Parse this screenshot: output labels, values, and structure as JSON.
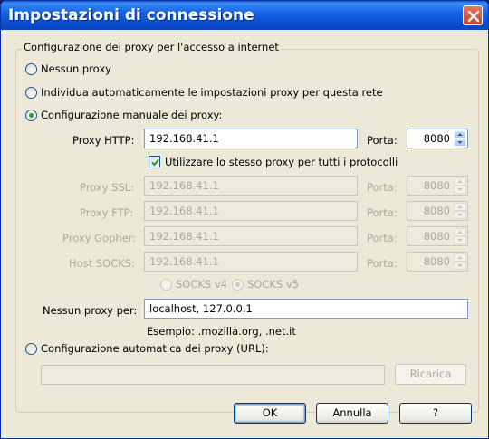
{
  "window": {
    "title": "Impostazioni di connessione"
  },
  "group": {
    "title": "Configurazione dei proxy per l'accesso a internet"
  },
  "options": {
    "no_proxy": "Nessun proxy",
    "auto_detect": "Individua automaticamente le impostazioni proxy per questa rete",
    "manual": "Configurazione manuale dei proxy:",
    "auto_url": "Configurazione automatica dei proxy (URL):"
  },
  "proxies": {
    "port_label": "Porta:",
    "http": {
      "label": "Proxy HTTP:",
      "host": "192.168.41.1",
      "port": "8080"
    },
    "ssl": {
      "label": "Proxy SSL:",
      "host": "192.168.41.1",
      "port": "8080"
    },
    "ftp": {
      "label": "Proxy FTP:",
      "host": "192.168.41.1",
      "port": "8080"
    },
    "gopher": {
      "label": "Proxy Gopher:",
      "host": "192.168.41.1",
      "port": "8080"
    },
    "socks": {
      "label": "Host SOCKS:",
      "host": "192.168.41.1",
      "port": "8080"
    },
    "same_proxy": "Utilizzare lo stesso proxy per tutti i protocolli",
    "socks_v4": "SOCKS v4",
    "socks_v5": "SOCKS v5"
  },
  "no_proxy_for": {
    "label": "Nessun proxy per:",
    "value": "localhost, 127.0.0.1",
    "example": "Esempio: .mozilla.org, .net.it"
  },
  "auto_config": {
    "url": "",
    "reload_label": "Ricarica"
  },
  "buttons": {
    "ok": "OK",
    "cancel": "Annulla",
    "help": "?"
  }
}
